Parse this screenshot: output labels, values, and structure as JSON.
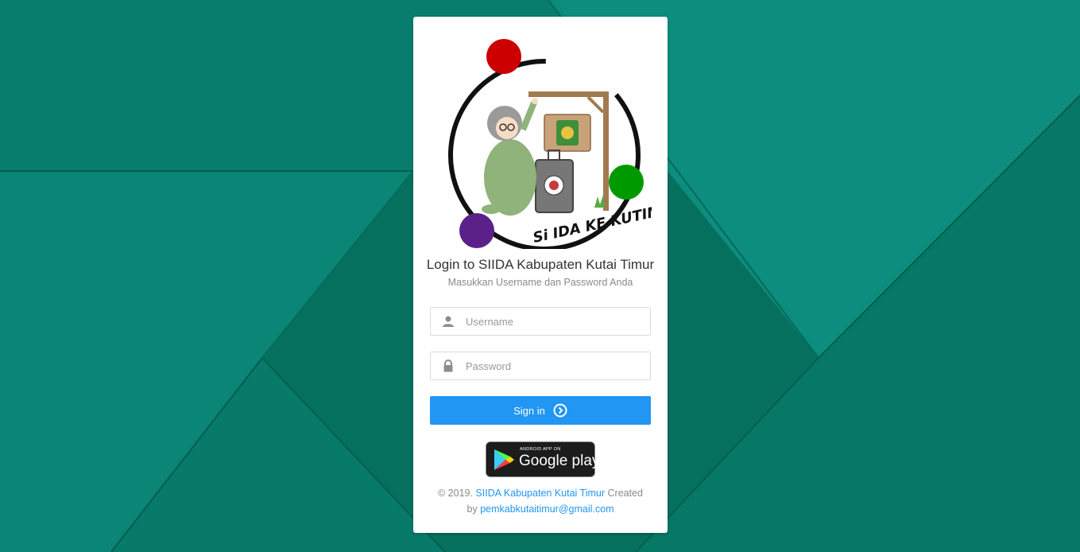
{
  "login": {
    "logo_text": "Si IDA KE KUTIM",
    "title": "Login to SIIDA Kabupaten Kutai Timur",
    "subtitle": "Masukkan Username dan Password Anda",
    "username_placeholder": "Username",
    "password_placeholder": "Password",
    "signin_label": "Sign in"
  },
  "google_play": {
    "small_text": "ANDROID APP ON",
    "big_text": "Google play"
  },
  "footer": {
    "copyright": "© 2019.",
    "site_link": "SIIDA Kabupaten Kutai Timur",
    "created": "Created",
    "by": "by",
    "email_link": "pemkabkutaitimur@gmail.com"
  },
  "colors": {
    "background": "#0b8a7a",
    "accent": "#2196f3",
    "dot_red": "#cc0000",
    "dot_green": "#009900",
    "dot_purple": "#5b2189"
  }
}
